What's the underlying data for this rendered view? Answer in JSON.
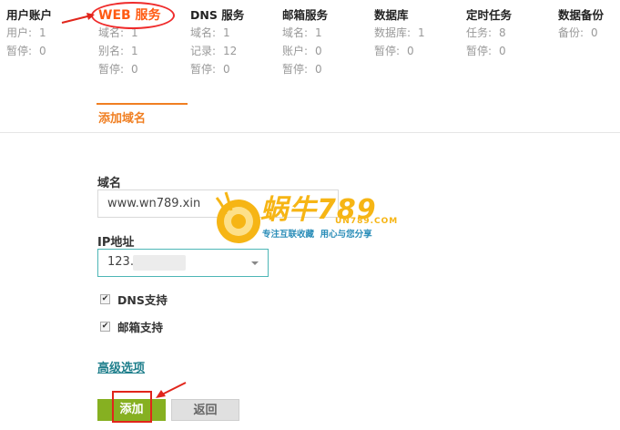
{
  "columns": [
    {
      "title": "用户账户",
      "stats": [
        {
          "k": "用户:",
          "v": "1"
        },
        {
          "k": "暂停:",
          "v": "0"
        }
      ]
    },
    {
      "title": "WEB 服务",
      "stats": [
        {
          "k": "域名:",
          "v": "1"
        },
        {
          "k": "别名:",
          "v": "1"
        },
        {
          "k": "暂停:",
          "v": "0"
        }
      ]
    },
    {
      "title": "DNS 服务",
      "stats": [
        {
          "k": "域名:",
          "v": "1"
        },
        {
          "k": "记录:",
          "v": "12"
        },
        {
          "k": "暂停:",
          "v": "0"
        }
      ]
    },
    {
      "title": "邮箱服务",
      "stats": [
        {
          "k": "域名:",
          "v": "1"
        },
        {
          "k": "账户:",
          "v": "0"
        },
        {
          "k": "暂停:",
          "v": "0"
        }
      ]
    },
    {
      "title": "数据库",
      "stats": [
        {
          "k": "数据库:",
          "v": "1"
        },
        {
          "k": "暂停:",
          "v": "0"
        }
      ]
    },
    {
      "title": "定时任务",
      "stats": [
        {
          "k": "任务:",
          "v": "8"
        },
        {
          "k": "暂停:",
          "v": "0"
        }
      ]
    },
    {
      "title": "数据备份",
      "stats": [
        {
          "k": "备份:",
          "v": "0"
        }
      ]
    }
  ],
  "tab": {
    "active_label": "添加域名"
  },
  "form": {
    "domain_label": "域名",
    "domain_value": "www.wn789.xin",
    "ip_label": "IP地址",
    "ip_value": "123.5",
    "dns_label": "DNS支持",
    "mail_label": "邮箱支持",
    "advanced_label": "高级选项",
    "add_label": "添加",
    "back_label": "返回"
  },
  "watermark": {
    "brand": "蜗牛789",
    "site": "UN789.COM",
    "slogan": "专注互联收藏  用心与您分享"
  },
  "colors": {
    "accent": "#f07f22",
    "add_button": "#86b021",
    "annotation_red": "#e1251b"
  }
}
